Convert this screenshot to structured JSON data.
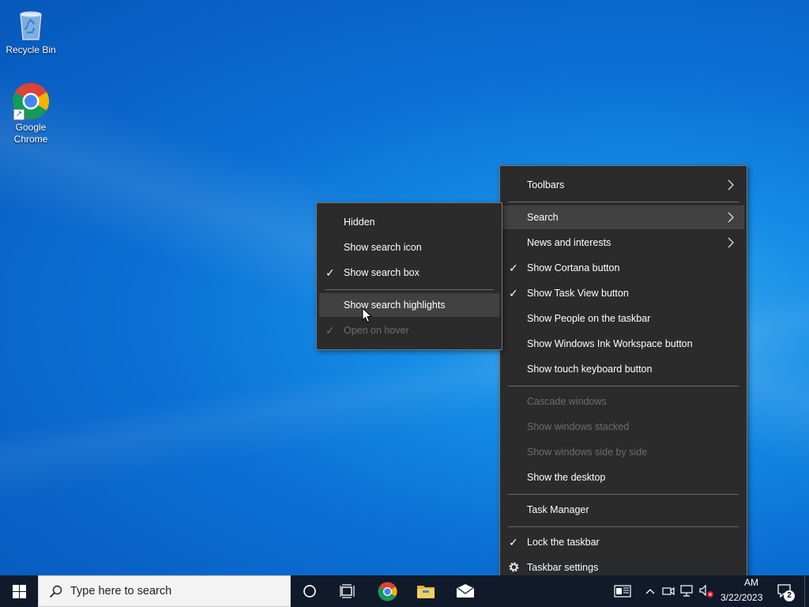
{
  "desktop": {
    "icons": [
      {
        "label": "Recycle Bin",
        "icon": "recycle-bin-icon"
      },
      {
        "label": "Google\nChrome",
        "icon": "chrome-icon"
      }
    ]
  },
  "taskbar_menu": {
    "items": [
      {
        "label": "Toolbars",
        "submenu": true
      },
      {
        "label": "Search",
        "submenu": true,
        "highlighted": true
      },
      {
        "label": "News and interests",
        "submenu": true
      },
      {
        "label": "Show Cortana button",
        "checked": true
      },
      {
        "label": "Show Task View button",
        "checked": true
      },
      {
        "label": "Show People on the taskbar"
      },
      {
        "label": "Show Windows Ink Workspace button"
      },
      {
        "label": "Show touch keyboard button"
      },
      {
        "label": "Cascade windows",
        "disabled": true
      },
      {
        "label": "Show windows stacked",
        "disabled": true
      },
      {
        "label": "Show windows side by side",
        "disabled": true
      },
      {
        "label": "Show the desktop"
      },
      {
        "label": "Task Manager"
      },
      {
        "label": "Lock the taskbar",
        "checked": true
      },
      {
        "label": "Taskbar settings",
        "icon": "gear-icon"
      }
    ]
  },
  "search_submenu": {
    "items": [
      {
        "label": "Hidden"
      },
      {
        "label": "Show search icon"
      },
      {
        "label": "Show search box",
        "checked": true
      },
      {
        "label": "Show search highlights",
        "highlighted": true
      },
      {
        "label": "Open on hover",
        "checked": true,
        "disabled": true
      }
    ]
  },
  "taskbar": {
    "search_placeholder": "Type here to search",
    "pinned": [
      "cortana-icon",
      "task-view-icon",
      "chrome-icon",
      "file-explorer-icon",
      "mail-icon"
    ],
    "clock_time_partial": "AM",
    "clock_date": "3/22/2023",
    "notification_count": "2"
  },
  "colors": {
    "menu_bg": "#2b2b2b",
    "menu_highlight": "#414141",
    "taskbar_bg": "#101a2a",
    "desktop_blue": "#0a70d3"
  }
}
